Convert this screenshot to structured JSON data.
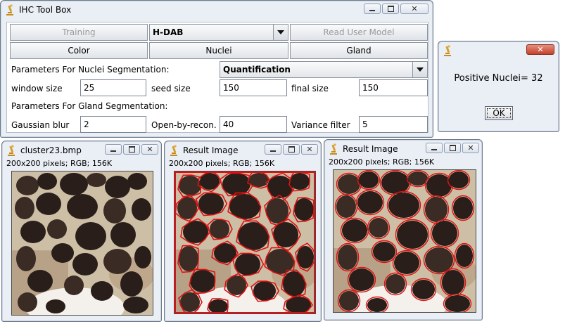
{
  "main_window": {
    "title": "IHC Tool Box",
    "training_label": "Training",
    "stain_select_value": "H-DAB",
    "read_user_model_label": "Read User Model",
    "tabs": [
      "Color",
      "Nuclei",
      "Gland"
    ],
    "nuclei_params_heading": "Parameters For Nuclei Segmentation:",
    "mode_select_value": "Quantification",
    "window_size_label": "window size",
    "window_size_value": "25",
    "seed_size_label": "seed size",
    "seed_size_value": "150",
    "final_size_label": "final size",
    "final_size_value": "150",
    "gland_params_heading": "Parameters For Gland Segmentation:",
    "gaussian_blur_label": "Gaussian blur",
    "gaussian_blur_value": "2",
    "open_by_recon_label": "Open-by-recon.",
    "open_by_recon_value": "40",
    "variance_filter_label": "Variance filter",
    "variance_filter_value": "5"
  },
  "dialog": {
    "message": "Positive Nuclei= 32",
    "ok_label": "OK"
  },
  "image_windows": [
    {
      "title": "cluster23.bmp",
      "info": "200x200 pixels; RGB; 156K"
    },
    {
      "title": "Result Image",
      "info": "200x200 pixels; RGB; 156K"
    },
    {
      "title": "Result Image",
      "info": "200x200 pixels; RGB; 156K"
    }
  ],
  "icons": {
    "app": "microscope-icon",
    "minimize": "minimize-icon",
    "maximize": "maximize-icon",
    "close": "close-icon",
    "dropdown": "chevron-down-icon"
  },
  "colors": {
    "window_frame": "#eaeef5",
    "close_button": "#c5412a",
    "segmentation_outline": "#e01010"
  }
}
